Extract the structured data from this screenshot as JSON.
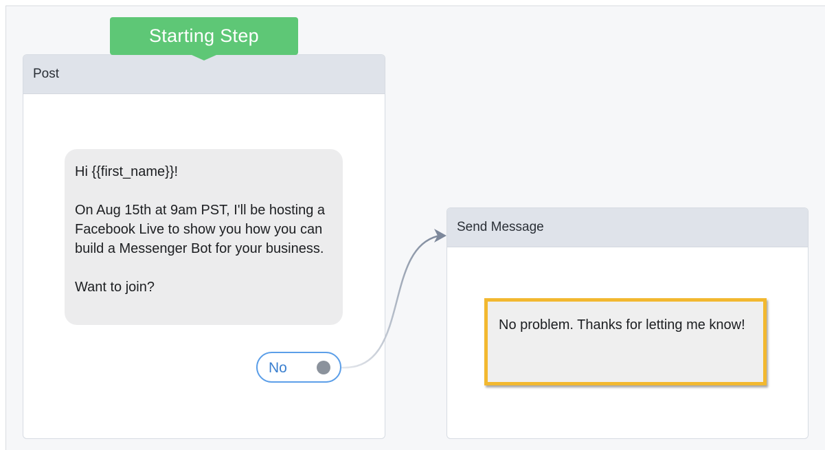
{
  "start_badge": {
    "label": "Starting Step"
  },
  "post_node": {
    "title": "Post",
    "message": "Hi {{first_name}}!\n\nOn Aug 15th at 9am PST, I'll be hosting a Facebook Live to show you how you can build a Messenger Bot for your business.\n\nWant to join?",
    "quick_reply": {
      "label": "No"
    }
  },
  "send_message_node": {
    "title": "Send Message",
    "message": "No problem. Thanks for letting me know!"
  },
  "colors": {
    "start_badge": "#5ec776",
    "node_header": "#dfe3ea",
    "bubble": "#ececed",
    "quick_reply_border": "#5b9ee8",
    "selected_card_border": "#f2b830",
    "connector": "#8a94a6"
  },
  "icons": {
    "connector_handle": "circle-dot-icon",
    "connector_arrow": "arrow-right-icon"
  }
}
